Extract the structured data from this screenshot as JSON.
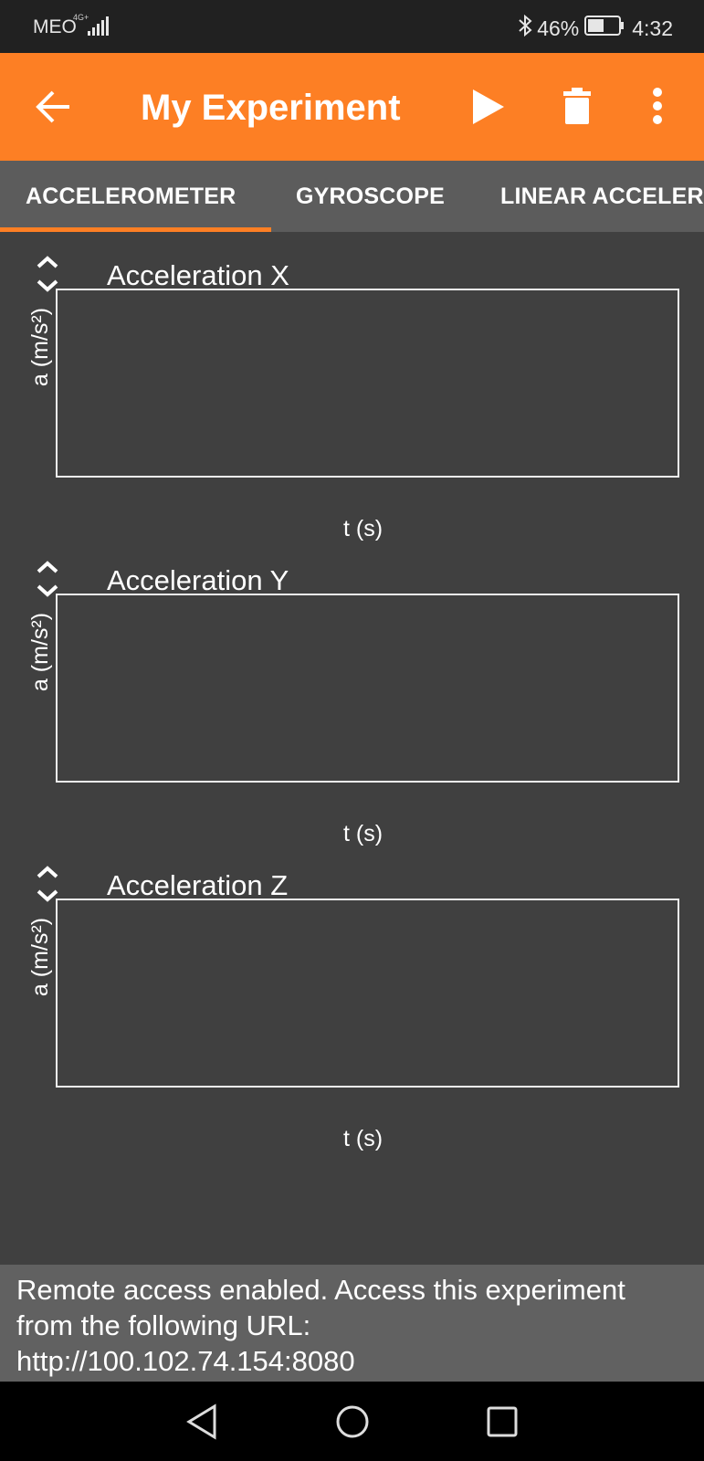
{
  "status_bar": {
    "carrier": "MEO",
    "network": "4G+",
    "battery_percent": "46%",
    "time": "4:32"
  },
  "app_bar": {
    "title": "My Experiment",
    "icons": [
      "arrow-back-icon",
      "play-icon",
      "trash-icon",
      "more-vertical-icon"
    ]
  },
  "tabs": [
    {
      "label": "ACCELEROMETER",
      "selected": true
    },
    {
      "label": "GYROSCOPE",
      "selected": false
    },
    {
      "label": "LINEAR ACCELERATION",
      "selected": false
    }
  ],
  "graphs": [
    {
      "title": "Acceleration X",
      "ylabel": "a (m/s²)",
      "xlabel": "t (s)"
    },
    {
      "title": "Acceleration Y",
      "ylabel": "a (m/s²)",
      "xlabel": "t (s)"
    },
    {
      "title": "Acceleration Z",
      "ylabel": "a (m/s²)",
      "xlabel": "t (s)"
    }
  ],
  "remote_notice": {
    "line1": "Remote access enabled. Access this experiment",
    "line2": "from the following URL:",
    "line3": "http://100.102.74.154:8080"
  },
  "colors": {
    "accent": "#fd7f24",
    "background": "#404040",
    "tab_bar": "#5c5c5c",
    "notice_bar": "#616161"
  }
}
